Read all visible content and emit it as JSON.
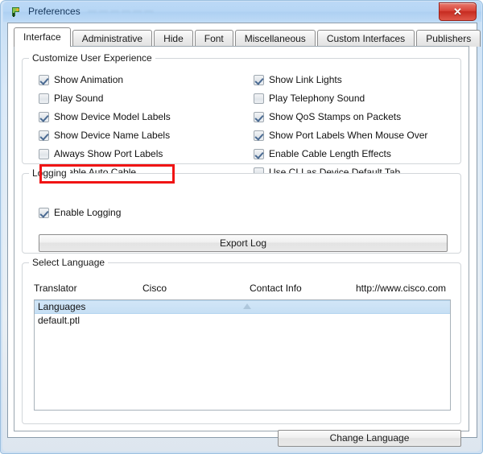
{
  "window": {
    "title": "Preferences",
    "ghost_title": "— — —  — —  —",
    "icon": "packet-tracer-icon",
    "close_label": "✕"
  },
  "tabs": [
    {
      "label": "Interface",
      "active": true
    },
    {
      "label": "Administrative",
      "active": false
    },
    {
      "label": "Hide",
      "active": false
    },
    {
      "label": "Font",
      "active": false
    },
    {
      "label": "Miscellaneous",
      "active": false
    },
    {
      "label": "Custom Interfaces",
      "active": false
    },
    {
      "label": "Publishers",
      "active": false
    }
  ],
  "customize": {
    "title": "Customize User Experience",
    "left_column": [
      {
        "label": "Show Animation",
        "checked": true
      },
      {
        "label": "Play Sound",
        "checked": false
      },
      {
        "label": "Show Device Model Labels",
        "checked": true
      },
      {
        "label": "Show Device Name Labels",
        "checked": true
      },
      {
        "label": "Always Show Port Labels",
        "checked": false,
        "highlighted": true
      },
      {
        "label": "Disable Auto Cable",
        "checked": false
      }
    ],
    "right_column": [
      {
        "label": "Show Link Lights",
        "checked": true
      },
      {
        "label": "Play Telephony Sound",
        "checked": false
      },
      {
        "label": "Show QoS Stamps on Packets",
        "checked": true
      },
      {
        "label": "Show Port Labels When Mouse Over",
        "checked": true
      },
      {
        "label": "Enable Cable Length Effects",
        "checked": true
      },
      {
        "label": "Use CLI as Device Default Tab",
        "checked": false
      }
    ]
  },
  "logging": {
    "title": "Logging",
    "enable_logging": {
      "label": "Enable Logging",
      "checked": true
    },
    "export_button": "Export Log"
  },
  "language": {
    "title": "Select Language",
    "columns": [
      "Translator",
      "Cisco",
      "Contact Info",
      "http://www.cisco.com"
    ],
    "items": [
      {
        "label": "Languages",
        "selected": true
      },
      {
        "label": "default.ptl",
        "selected": false
      }
    ],
    "change_button": "Change Language"
  },
  "colors": {
    "titlebar": "#b6d6f5",
    "close_button": "#d9453a",
    "highlight_red": "#f01414",
    "selection_blue": "#c6dff4",
    "frame_blue": "#cfe3f7"
  }
}
